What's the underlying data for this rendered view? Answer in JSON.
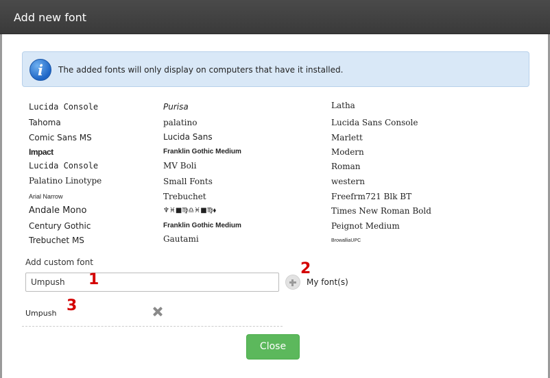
{
  "dialog": {
    "title": "Add new font"
  },
  "info": {
    "icon": "info-icon",
    "glyph": "i",
    "message": "The added fonts will only display on computers that have it installed."
  },
  "fonts": {
    "column1": [
      "Lucida Console",
      "Tahoma",
      "Comic Sans MS",
      "Impact",
      "Lucida Console",
      "Palatino Linotype",
      "Arial Narrow",
      "Andale Mono",
      "Century Gothic",
      "Trebuchet MS"
    ],
    "column2": [
      "Purisa",
      "palatino",
      "Lucida Sans",
      "Franklin Gothic Medium",
      "MV Boli",
      "Small Fonts",
      "Trebuchet",
      "♆♓■♍♎♓■♍⬧",
      "Franklin Gothic Medium",
      "Gautami"
    ],
    "column3": [
      "Latha",
      "Lucida Sans Console",
      "Marlett",
      "Modern",
      "Roman",
      "western",
      "Freefrm721 Blk BT",
      "Times New Roman Bold",
      "Peignot Medium",
      "BrowalliaUPC"
    ]
  },
  "custom_font": {
    "label": "Add custom font",
    "input_value": "Umpush",
    "add_icon": "plus-icon",
    "my_fonts_label": "My font(s)"
  },
  "my_fonts": [
    {
      "name": "Umpush",
      "remove_icon": "close-icon"
    }
  ],
  "annotations": {
    "marker_1": "1",
    "marker_2": "2",
    "marker_3": "3",
    "color": "#d40000"
  },
  "buttons": {
    "close_label": "Close",
    "close_color": "#5cb85c"
  }
}
